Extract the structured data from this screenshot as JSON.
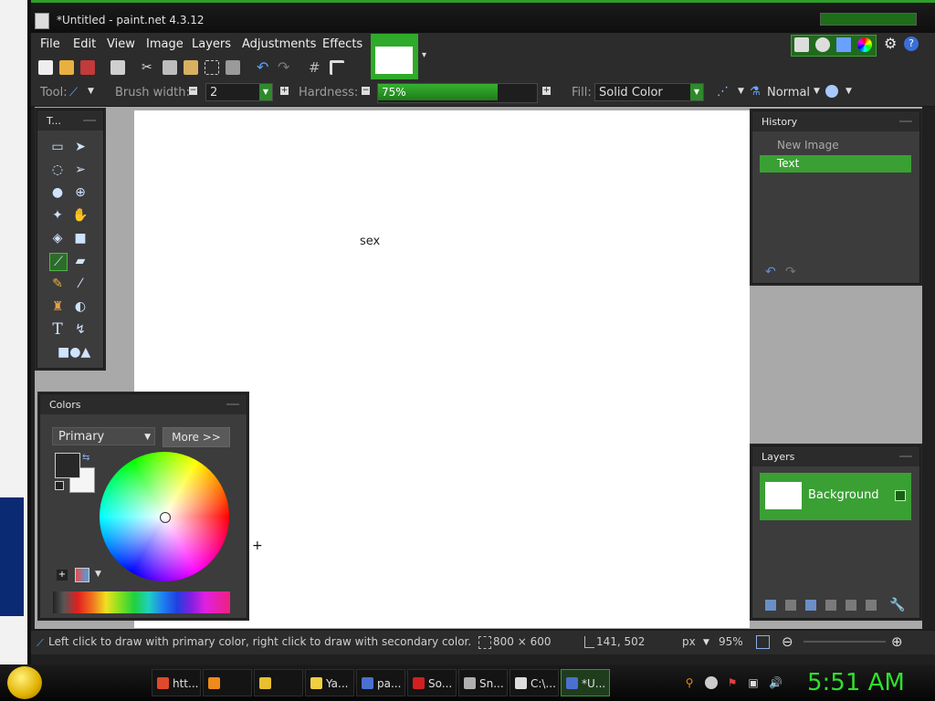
{
  "window": {
    "title": "*Untitled - paint.net 4.3.12"
  },
  "menu": [
    "File",
    "Edit",
    "View",
    "Image",
    "Layers",
    "Adjustments",
    "Effects"
  ],
  "toolbar": {
    "tool_label": "Tool:",
    "brush_width_label": "Brush width:",
    "brush_width_value": "2",
    "hardness_label": "Hardness:",
    "hardness_value": "75%",
    "hardness_fraction": 0.75,
    "fill_label": "Fill:",
    "fill_value": "Solid Color",
    "blend_mode": "Normal"
  },
  "canvas": {
    "text": "sex"
  },
  "tools_panel": {
    "title": "T..."
  },
  "history": {
    "title": "History",
    "items": [
      {
        "label": "New Image",
        "selected": false
      },
      {
        "label": "Text",
        "selected": true
      }
    ]
  },
  "layers": {
    "title": "Layers",
    "items": [
      {
        "label": "Background"
      }
    ]
  },
  "colors": {
    "title": "Colors",
    "mode": "Primary",
    "more_label": "More >>",
    "primary_color": "#282828",
    "secondary_color": "#f5f5f5"
  },
  "status": {
    "hint": "Left click to draw with primary color, right click to draw with secondary color.",
    "image_size": "800 × 600",
    "cursor_pos": "141, 502",
    "unit": "px",
    "zoom": "95%"
  },
  "taskbar": {
    "items": [
      {
        "label": "htt...",
        "color": "#e04a2a"
      },
      {
        "label": "",
        "color": "#f08a1a"
      },
      {
        "label": "",
        "color": "#e8c030"
      },
      {
        "label": "Ya...",
        "color": "#f0d040"
      },
      {
        "label": "pa...",
        "color": "#4a70d0"
      },
      {
        "label": "So...",
        "color": "#d02020"
      },
      {
        "label": "Sn...",
        "color": "#b0b0b0"
      },
      {
        "label": "C:\\...",
        "color": "#dddddd"
      },
      {
        "label": "*U...",
        "color": "#4a70d0",
        "active": true
      }
    ],
    "clock": "5:51 AM"
  },
  "colors_accent": {
    "brand_green": "#2faa2a",
    "selection_green": "#3aa034"
  }
}
